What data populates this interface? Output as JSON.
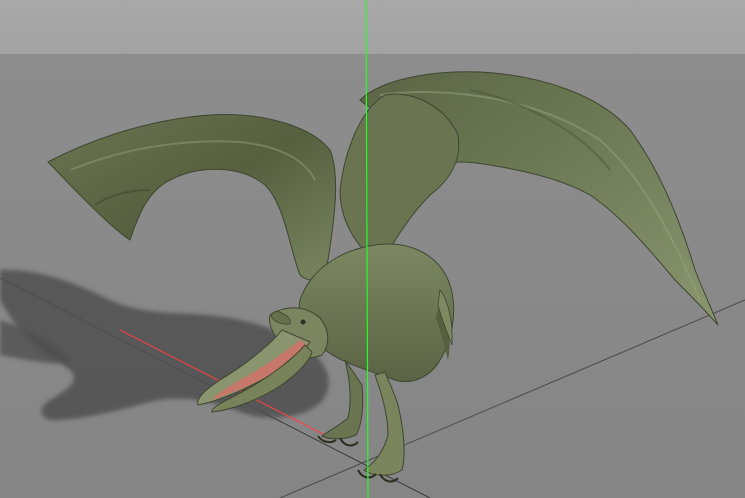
{
  "scene": {
    "model": "pterosaur-creature",
    "colors": {
      "sky": "#a6a6a6",
      "ground": "#898989",
      "shadow": "#4f4f4f",
      "skin_dark": "#4e563c",
      "skin_mid": "#6f7a56",
      "skin_light": "#8e9a72",
      "mouth": "#c8786a",
      "axis_y": "#22ff22",
      "axis_x": "#ff3333",
      "grid_line": "#3a3a3a"
    }
  }
}
